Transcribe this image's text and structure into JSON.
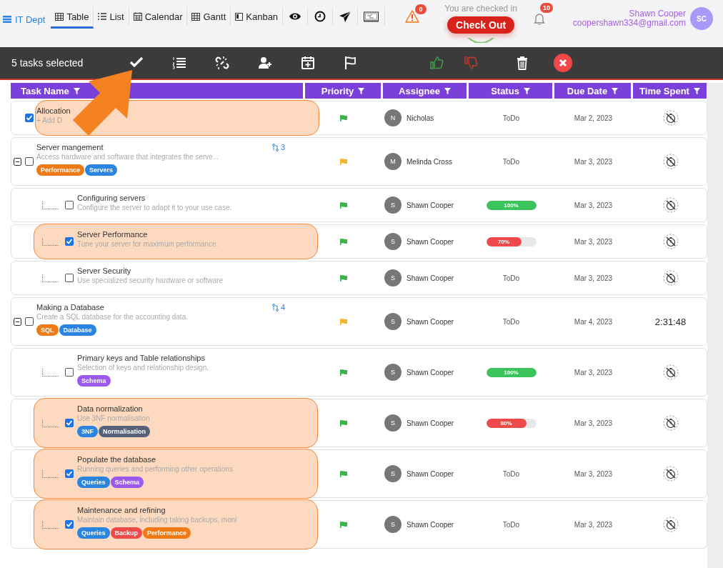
{
  "workspace": {
    "label": "IT Dept"
  },
  "view_tabs": [
    {
      "label": "Table",
      "selected": true
    },
    {
      "label": "List",
      "selected": false
    },
    {
      "label": "Calendar",
      "selected": false
    },
    {
      "label": "Gantt",
      "selected": false
    },
    {
      "label": "Kanban",
      "selected": false
    }
  ],
  "alerts": {
    "count": "0"
  },
  "checkin": {
    "status": "You are checked in",
    "button": "Check Out"
  },
  "notifications": {
    "count": "10"
  },
  "user": {
    "name": "Shawn Cooper",
    "email": "coopershawn334@gmail.com",
    "initials": "SC"
  },
  "selection_bar": {
    "label": "5 tasks selected"
  },
  "table": {
    "columns": [
      "Task Name",
      "Priority",
      "Assignee",
      "Status",
      "Due Date",
      "Time Spent"
    ],
    "rows": [
      {
        "title": "Allocation",
        "description": "+ Add D",
        "selected": true,
        "highlighted": true,
        "priority": {
          "color": "#3cb44b"
        },
        "assignee": {
          "initial": "N",
          "name": "Nicholas"
        },
        "status": {
          "kind": "text",
          "label": "ToDo"
        },
        "due": "Mar 2, 2023",
        "time_spent": {
          "kind": "icon"
        }
      },
      {
        "title": "Server mangement",
        "description": "Access hardware and software that integrates the serve...",
        "selected": false,
        "highlighted": false,
        "expanded": true,
        "subtask_count": "3",
        "tags": [
          {
            "label": "Performance",
            "color": "#f07b16"
          },
          {
            "label": "Servers",
            "color": "#2a84e0"
          }
        ],
        "priority": {
          "color": "#f5b52a"
        },
        "assignee": {
          "initial": "M",
          "name": "Melinda Cross"
        },
        "status": {
          "kind": "text",
          "label": "ToDo"
        },
        "due": "Mar 3, 2023",
        "time_spent": {
          "kind": "icon"
        },
        "children": [
          {
            "title": "Configuring servers",
            "description": "Configure the server to adapt it to your use case.",
            "selected": false,
            "highlighted": false,
            "priority": {
              "color": "#3cb44b"
            },
            "assignee": {
              "initial": "S",
              "name": "Shawn Cooper"
            },
            "status": {
              "kind": "progress",
              "label": "100%",
              "level": 1,
              "color": "#3cc45c"
            },
            "due": "Mar 3, 2023",
            "time_spent": {
              "kind": "icon"
            }
          },
          {
            "title": "Server Performance",
            "description": "Tune your server for maximum performance.",
            "selected": true,
            "highlighted": true,
            "priority": {
              "color": "#3cb44b"
            },
            "assignee": {
              "initial": "S",
              "name": "Shawn Cooper"
            },
            "status": {
              "kind": "progress",
              "label": "70%",
              "level": 0.7,
              "color": "#ee4a4a"
            },
            "due": "Mar 3, 2023",
            "time_spent": {
              "kind": "icon"
            }
          },
          {
            "title": "Server Security",
            "description": "Use specialized security hardware or software",
            "selected": false,
            "highlighted": false,
            "priority": {
              "color": "#3cb44b"
            },
            "assignee": {
              "initial": "S",
              "name": "Shawn Cooper"
            },
            "status": {
              "kind": "text",
              "label": "ToDo"
            },
            "due": "Mar 3, 2023",
            "time_spent": {
              "kind": "icon"
            }
          }
        ]
      },
      {
        "title": "Making a Database",
        "description": "Create a SQL database for the accounting data.",
        "selected": false,
        "highlighted": false,
        "expanded": true,
        "subtask_count": "4",
        "tags": [
          {
            "label": "SQL",
            "color": "#f07b16"
          },
          {
            "label": "Database",
            "color": "#2a84e0"
          }
        ],
        "priority": {
          "color": "#f5b52a"
        },
        "assignee": {
          "initial": "S",
          "name": "Shawn Cooper"
        },
        "status": {
          "kind": "text",
          "label": "ToDo"
        },
        "due": "Mar 4, 2023",
        "time_spent": {
          "kind": "text",
          "label": "2:31:48"
        },
        "children": [
          {
            "title": "Primary keys and Table relationships",
            "description": "Selection of keys and relationship design.",
            "selected": false,
            "highlighted": false,
            "tags": [
              {
                "label": "Schema",
                "color": "#9b59f0"
              }
            ],
            "priority": {
              "color": "#3cb44b"
            },
            "assignee": {
              "initial": "S",
              "name": "Shawn Cooper"
            },
            "status": {
              "kind": "progress",
              "label": "100%",
              "level": 1,
              "color": "#3cc45c"
            },
            "due": "Mar 3, 2023",
            "time_spent": {
              "kind": "icon"
            }
          },
          {
            "title": "Data normalization",
            "description": "Use 3NF normalisation",
            "selected": true,
            "highlighted": true,
            "tags": [
              {
                "label": "3NF",
                "color": "#2a84e0"
              },
              {
                "label": "Normalisation",
                "color": "#56627a"
              }
            ],
            "priority": {
              "color": "#3cb44b"
            },
            "assignee": {
              "initial": "S",
              "name": "Shawn Cooper"
            },
            "status": {
              "kind": "progress",
              "label": "80%",
              "level": 0.8,
              "color": "#ee4a4a"
            },
            "due": "Mar 3, 2023",
            "time_spent": {
              "kind": "icon"
            }
          },
          {
            "title": "Populate the database",
            "description": "Running queries and performing other operations",
            "selected": true,
            "highlighted": true,
            "tags": [
              {
                "label": "Queries",
                "color": "#2a84e0"
              },
              {
                "label": "Schema",
                "color": "#9b59f0"
              }
            ],
            "priority": {
              "color": "#3cb44b"
            },
            "assignee": {
              "initial": "S",
              "name": "Shawn Cooper"
            },
            "status": {
              "kind": "text",
              "label": "ToDo"
            },
            "due": "Mar 3, 2023",
            "time_spent": {
              "kind": "icon"
            }
          },
          {
            "title": "Maintenance and refining",
            "description": "Maintain database, including taking backups, moni",
            "selected": true,
            "highlighted": true,
            "tags": [
              {
                "label": "Queries",
                "color": "#2a84e0"
              },
              {
                "label": "Backup",
                "color": "#ee4a4a"
              },
              {
                "label": "Performance",
                "color": "#f07b16"
              }
            ],
            "priority": {
              "color": "#3cb44b"
            },
            "assignee": {
              "initial": "S",
              "name": "Shawn Cooper"
            },
            "status": {
              "kind": "text",
              "label": "ToDo"
            },
            "due": "Mar 3, 2023",
            "time_spent": {
              "kind": "icon"
            }
          }
        ]
      }
    ]
  }
}
